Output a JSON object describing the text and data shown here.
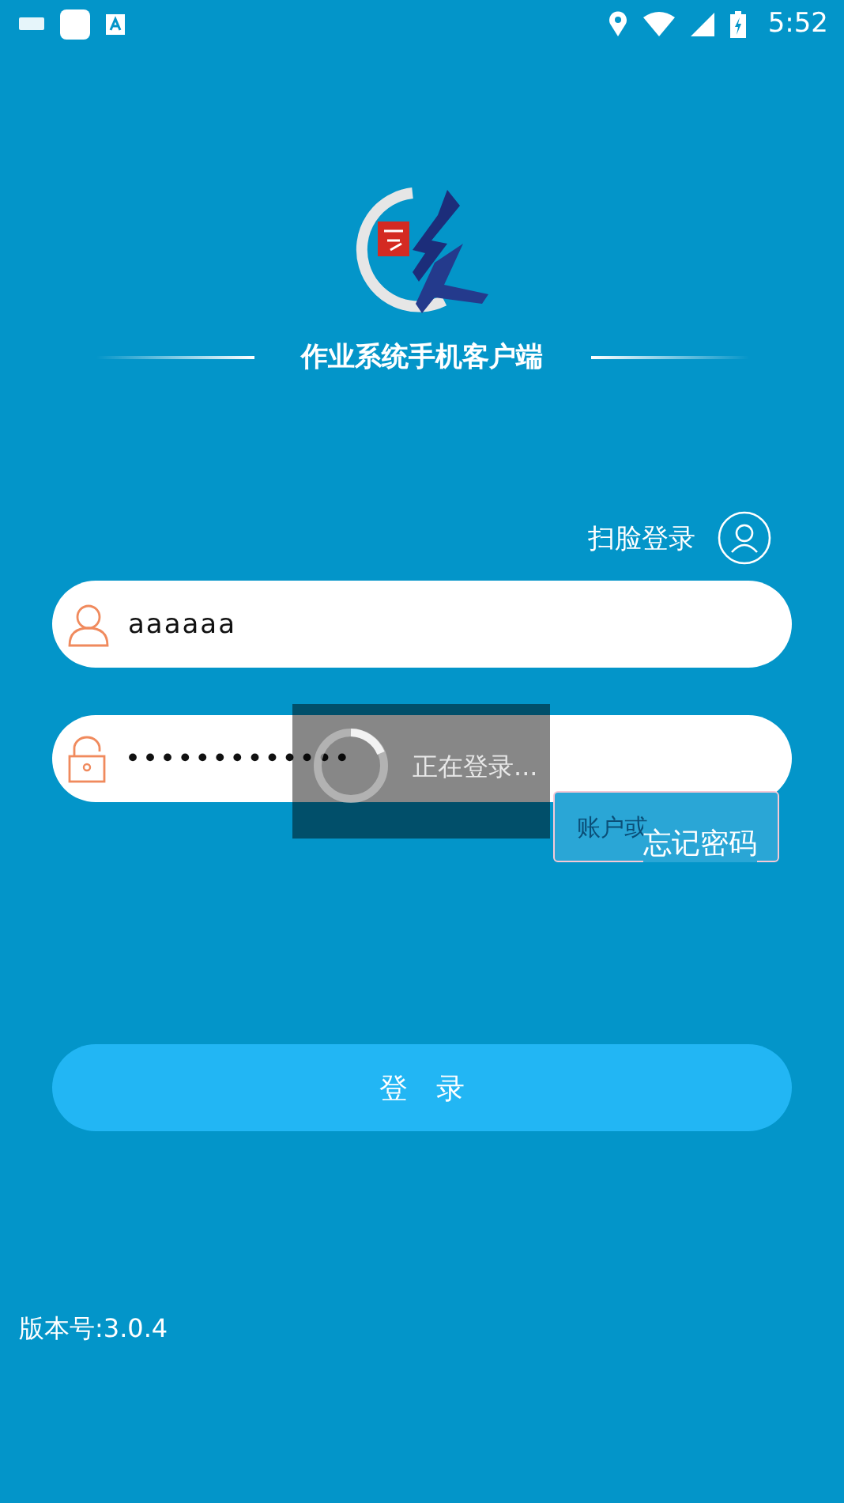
{
  "status_bar": {
    "time": "5:52"
  },
  "header": {
    "title": "作业系统手机客户端"
  },
  "face_login": {
    "label": "扫脸登录"
  },
  "username": {
    "value": "aaaaaa"
  },
  "password": {
    "value": "•••••••••••••"
  },
  "loading_dialog": {
    "text": "正在登录..."
  },
  "error_tooltip": {
    "text": "账户或"
  },
  "forgot_password": "忘记密码",
  "login_button": "登　录",
  "version": "版本号:3.0.4"
}
